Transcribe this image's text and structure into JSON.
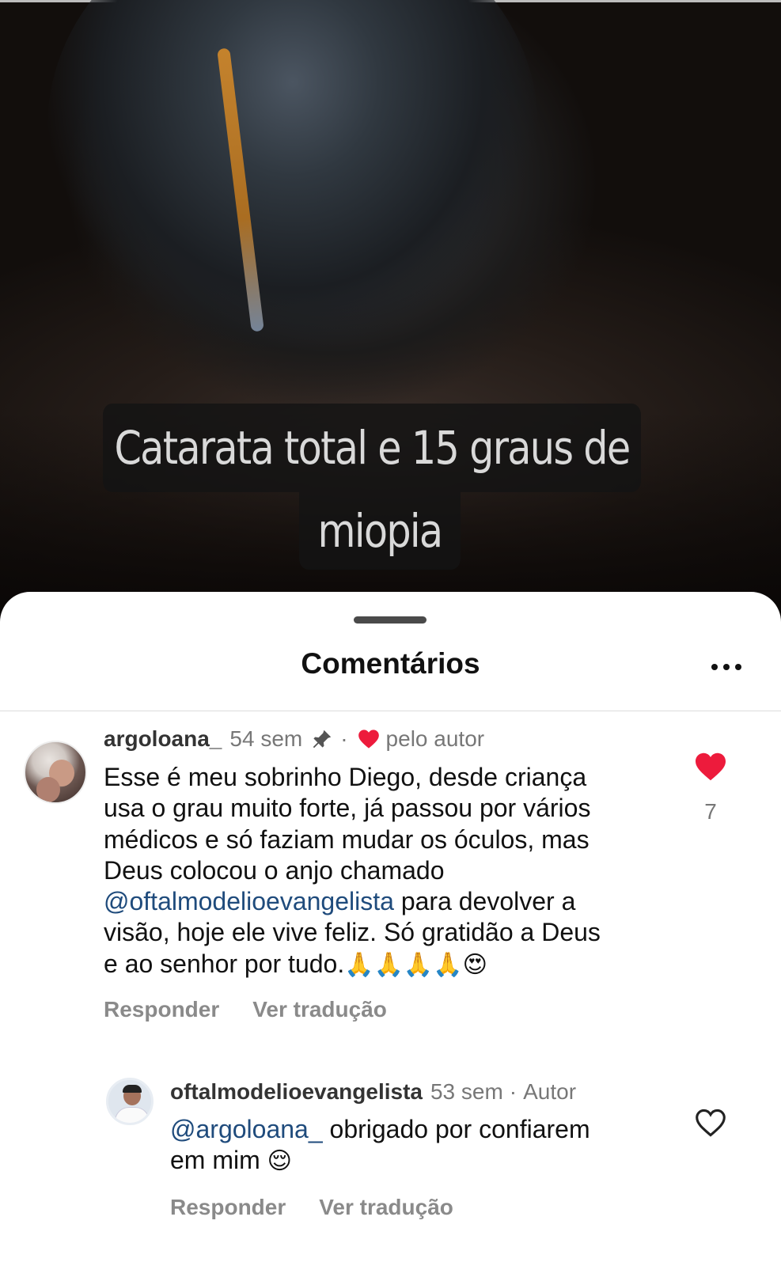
{
  "video": {
    "caption_line1": "Catarata total e 15 graus de",
    "caption_line2": "miopia"
  },
  "sheet": {
    "title": "Comentários",
    "more_icon": "more-horizontal-icon"
  },
  "comments": [
    {
      "username": "argoloana_",
      "time": "54 sem",
      "pinned_icon": "pin-icon",
      "liked_by_author": "pelo autor",
      "text_lines": [
        "Esse é meu sobrinho Diego, desde criança",
        "usa o grau muito forte, já passou por vários",
        "médicos e só faziam mudar os óculos, mas",
        "Deus colocou o anjo chamado"
      ],
      "mention": "@oftalmodelioevangelista",
      "text_after_mention": " para devolver a",
      "text_line6": "visão, hoje ele vive feliz. Só gratidão a Deus",
      "text_line7": "e ao senhor por tudo.",
      "emojis": "🙏🙏🙏🙏😍",
      "likes": "7",
      "liked": true,
      "actions": {
        "reply": "Responder",
        "translate": "Ver tradução"
      }
    },
    {
      "username": "oftalmodelioevangelista",
      "time": "53 sem",
      "badge": "Autor",
      "mention": "@argoloana_",
      "text_after_mention": " obrigado por confiarem",
      "text_line2": "em mim",
      "emoji": "😌",
      "liked": false,
      "actions": {
        "reply": "Responder",
        "translate": "Ver tradução"
      }
    }
  ],
  "colors": {
    "like_red": "#ed1b3c",
    "mention_blue": "#1f4b7c",
    "muted_gray": "#8a8a8a"
  }
}
